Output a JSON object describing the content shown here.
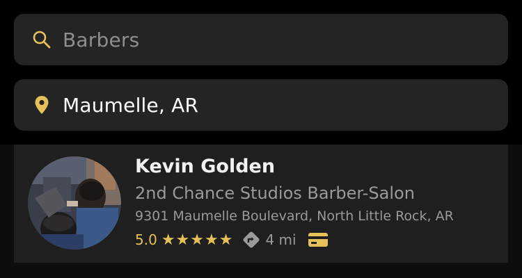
{
  "search": {
    "placeholder": "Barbers",
    "icon": "search-icon"
  },
  "location": {
    "value": "Maumelle, AR",
    "icon": "location-pin-icon"
  },
  "result": {
    "name": "Kevin Golden",
    "shop": "2nd Chance Studios Barber-Salon",
    "address": "9301 Maumelle Boulevard, North Little Rock, AR",
    "rating": "5.0",
    "stars": "★★★★★",
    "distance": "4 mi",
    "direction_icon": "directions-icon",
    "payment_icon": "credit-card-icon"
  },
  "colors": {
    "accent": "#e6c15a",
    "field_bg": "#242424",
    "card_bg": "#1f1f1f",
    "muted_text": "#9a9a9a"
  }
}
